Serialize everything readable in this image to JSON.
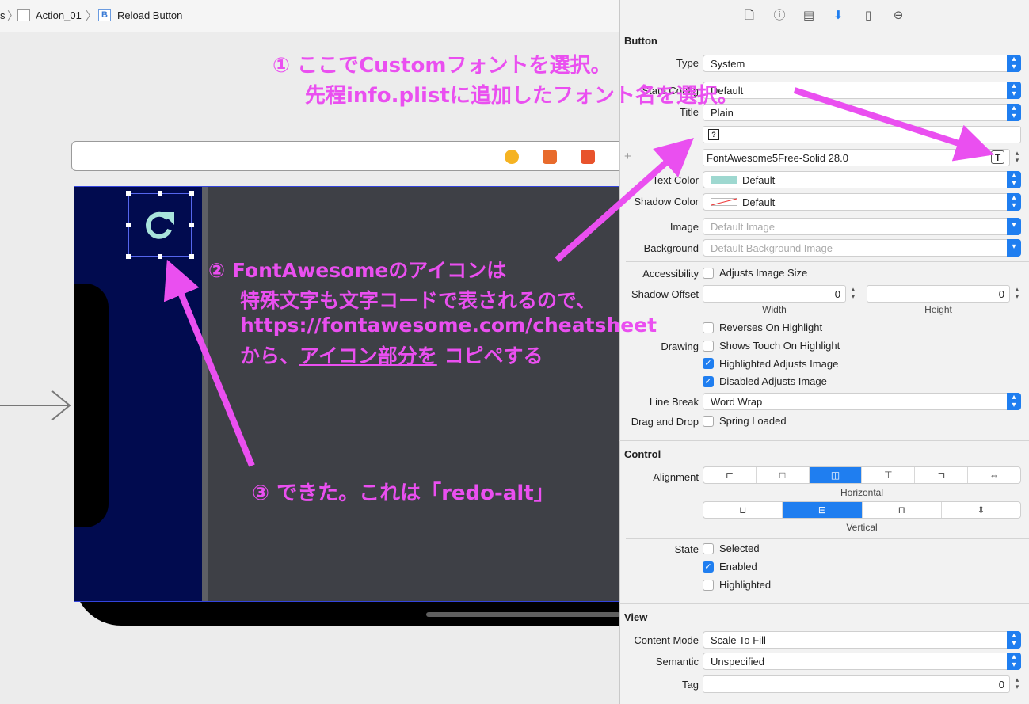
{
  "breadcrumb": {
    "partial": "s",
    "item1": "Action_01",
    "item2_badge": "B",
    "item2": "Reload Button"
  },
  "scene_icons": [
    {
      "name": "first-responder-icon",
      "color": "#f5b322"
    },
    {
      "name": "cube-icon",
      "color": "#e86b2c"
    },
    {
      "name": "exit-icon",
      "color": "#e8532c"
    }
  ],
  "inspector_tabs": [
    "file-icon",
    "help-icon",
    "identity-icon",
    "attributes-icon",
    "size-icon",
    "connections-icon"
  ],
  "button_section": {
    "title": "Button",
    "type_label": "Type",
    "type_value": "System",
    "state_label": "State Config",
    "state_value": "Default",
    "title_label": "Title",
    "title_value": "Plain",
    "title_text": "?",
    "font_value": "FontAwesome5Free-Solid 28.0",
    "text_color_label": "Text Color",
    "text_color_value": "Default",
    "text_color_swatch": "#9ed8d0",
    "shadow_color_label": "Shadow Color",
    "shadow_color_value": "Default",
    "image_label": "Image",
    "image_placeholder": "Default Image",
    "background_label": "Background",
    "background_placeholder": "Default Background Image",
    "accessibility_label": "Accessibility",
    "adjusts_image_size": "Adjusts Image Size",
    "shadow_offset_label": "Shadow Offset",
    "shadow_offset_width": "0",
    "shadow_offset_height": "0",
    "width_label": "Width",
    "height_label": "Height",
    "reverses_on_highlight": "Reverses On Highlight",
    "drawing_label": "Drawing",
    "shows_touch": "Shows Touch On Highlight",
    "highlighted_adjusts": "Highlighted Adjusts Image",
    "disabled_adjusts": "Disabled Adjusts Image",
    "line_break_label": "Line Break",
    "line_break_value": "Word Wrap",
    "drag_drop_label": "Drag and Drop",
    "spring_loaded": "Spring Loaded"
  },
  "control_section": {
    "title": "Control",
    "alignment_label": "Alignment",
    "horizontal_label": "Horizontal",
    "vertical_label": "Vertical",
    "state_label": "State",
    "selected": "Selected",
    "enabled": "Enabled",
    "highlighted": "Highlighted"
  },
  "view_section": {
    "title": "View",
    "content_mode_label": "Content Mode",
    "content_mode_value": "Scale To Fill",
    "semantic_label": "Semantic",
    "semantic_value": "Unspecified",
    "tag_label": "Tag",
    "tag_value": "0"
  },
  "annotations": {
    "a1_line1": "① ここでCustomフォントを選択。",
    "a1_line2": "先程info.plistに追加したフォント名を選択。",
    "a2_line1": "② FontAwesomeのアイコンは",
    "a2_line2": "特殊文字も文字コードで表されるので、",
    "a2_line3": "https://fontawesome.com/cheatsheet",
    "a2_line4a": "から、",
    "a2_line4b": "アイコン部分を",
    "a2_line4c": " コピペする",
    "a3": "③ できた。これは「redo-alt」",
    "color": "#ea4ff0"
  },
  "checkbox_states": {
    "adjusts_image_size": false,
    "reverses_on_highlight": false,
    "shows_touch": false,
    "highlighted_adjusts": true,
    "disabled_adjusts": true,
    "spring_loaded": false,
    "selected": false,
    "enabled": true,
    "highlighted": false
  }
}
